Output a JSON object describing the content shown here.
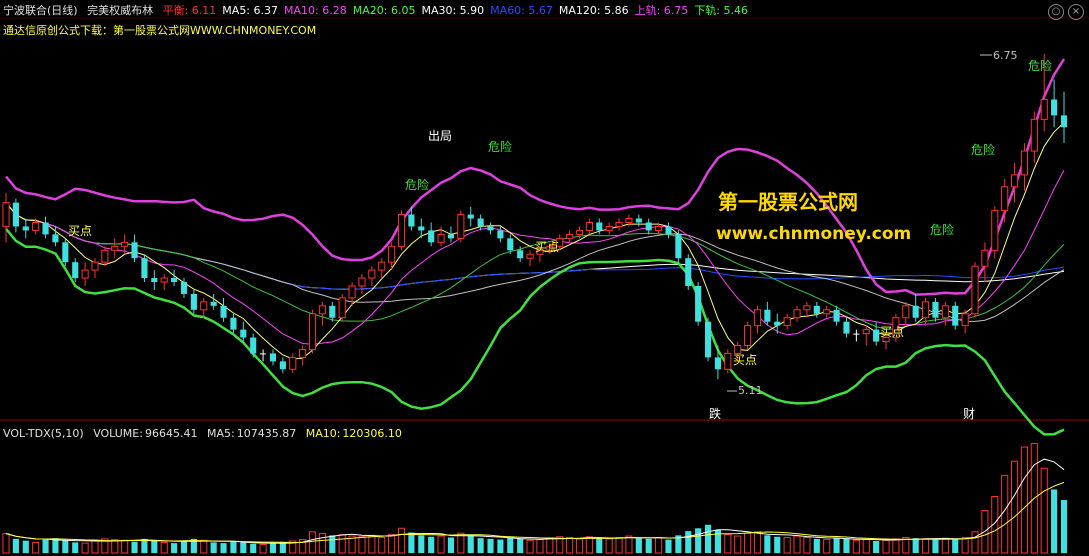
{
  "header": {
    "stock_name": "宁波联合",
    "period": "(日线)",
    "indicator": "完美权威布林",
    "items": [
      {
        "label": "平衡:",
        "value": "6.11",
        "color": "#ff3030"
      },
      {
        "label": "MA5:",
        "value": "6.37",
        "color": "#ffffff"
      },
      {
        "label": "MA10:",
        "value": "6.28",
        "color": "#ff40ff"
      },
      {
        "label": "MA20:",
        "value": "6.05",
        "color": "#40ff40"
      },
      {
        "label": "MA30:",
        "value": "5.90",
        "color": "#ffffff"
      },
      {
        "label": "MA60:",
        "value": "5.67",
        "color": "#2050ff"
      },
      {
        "label": "MA120:",
        "value": "5.86",
        "color": "#ffffff"
      },
      {
        "label": "上轨:",
        "value": "6.75",
        "color": "#ff40ff"
      },
      {
        "label": "下轨:",
        "value": "5.46",
        "color": "#40ff40"
      }
    ],
    "sub_text": "通达信原创公式下载：第一股票公式网WWW.CHNMONEY.COM"
  },
  "watermark": {
    "line1": "第一股票公式网",
    "line2": "www.chnmoney.com"
  },
  "annotations": {
    "buy": "买点",
    "danger": "危险",
    "exit": "出局",
    "drop": "跌",
    "cai": "财",
    "high_label": "6.75",
    "low_label": "5.11"
  },
  "volume_header": {
    "name": "VOL-TDX(5,10)",
    "volume_label": "VOLUME:",
    "volume_value": "96645.41",
    "ma5_label": "MA5:",
    "ma5_value": "107435.87",
    "ma10_label": "MA10:",
    "ma10_value": "120306.10"
  },
  "colors": {
    "up": "#ff3030",
    "down": "#40e0e0",
    "doji": "#ffffff",
    "upper": "#e040e0",
    "lower": "#40e040"
  },
  "chart_data": {
    "type": "candlestick",
    "ohlc": [
      [
        5.88,
        6.05,
        5.8,
        6.0
      ],
      [
        6.0,
        6.02,
        5.85,
        5.88
      ],
      [
        5.88,
        5.92,
        5.82,
        5.86
      ],
      [
        5.86,
        5.92,
        5.84,
        5.9
      ],
      [
        5.9,
        5.93,
        5.82,
        5.84
      ],
      [
        5.84,
        5.88,
        5.78,
        5.8
      ],
      [
        5.8,
        5.82,
        5.68,
        5.7
      ],
      [
        5.7,
        5.72,
        5.6,
        5.62
      ],
      [
        5.62,
        5.7,
        5.58,
        5.66
      ],
      [
        5.66,
        5.72,
        5.62,
        5.7
      ],
      [
        5.7,
        5.78,
        5.68,
        5.76
      ],
      [
        5.76,
        5.82,
        5.72,
        5.78
      ],
      [
        5.78,
        5.84,
        5.74,
        5.8
      ],
      [
        5.8,
        5.84,
        5.7,
        5.72
      ],
      [
        5.72,
        5.74,
        5.6,
        5.62
      ],
      [
        5.62,
        5.66,
        5.56,
        5.6
      ],
      [
        5.6,
        5.64,
        5.56,
        5.62
      ],
      [
        5.62,
        5.66,
        5.58,
        5.6
      ],
      [
        5.6,
        5.62,
        5.52,
        5.54
      ],
      [
        5.54,
        5.56,
        5.44,
        5.46
      ],
      [
        5.46,
        5.52,
        5.42,
        5.5
      ],
      [
        5.5,
        5.54,
        5.46,
        5.48
      ],
      [
        5.48,
        5.52,
        5.4,
        5.42
      ],
      [
        5.42,
        5.44,
        5.34,
        5.36
      ],
      [
        5.36,
        5.4,
        5.3,
        5.32
      ],
      [
        5.32,
        5.34,
        5.22,
        5.24
      ],
      [
        5.24,
        5.26,
        5.2,
        5.24
      ],
      [
        5.24,
        5.26,
        5.18,
        5.2
      ],
      [
        5.2,
        5.22,
        5.14,
        5.16
      ],
      [
        5.16,
        5.24,
        5.14,
        5.22
      ],
      [
        5.22,
        5.28,
        5.18,
        5.26
      ],
      [
        5.26,
        5.46,
        5.24,
        5.44
      ],
      [
        5.44,
        5.5,
        5.38,
        5.48
      ],
      [
        5.48,
        5.5,
        5.4,
        5.42
      ],
      [
        5.42,
        5.54,
        5.4,
        5.52
      ],
      [
        5.52,
        5.6,
        5.48,
        5.58
      ],
      [
        5.58,
        5.64,
        5.54,
        5.62
      ],
      [
        5.62,
        5.68,
        5.58,
        5.66
      ],
      [
        5.66,
        5.72,
        5.62,
        5.7
      ],
      [
        5.7,
        5.8,
        5.66,
        5.78
      ],
      [
        5.78,
        5.96,
        5.76,
        5.94
      ],
      [
        5.94,
        5.98,
        5.86,
        5.88
      ],
      [
        5.88,
        5.92,
        5.82,
        5.86
      ],
      [
        5.86,
        5.9,
        5.78,
        5.8
      ],
      [
        5.8,
        5.88,
        5.78,
        5.84
      ],
      [
        5.84,
        5.88,
        5.8,
        5.82
      ],
      [
        5.82,
        5.96,
        5.8,
        5.94
      ],
      [
        5.94,
        5.98,
        5.88,
        5.92
      ],
      [
        5.92,
        5.94,
        5.86,
        5.88
      ],
      [
        5.88,
        5.9,
        5.84,
        5.86
      ],
      [
        5.86,
        5.88,
        5.8,
        5.82
      ],
      [
        5.82,
        5.84,
        5.74,
        5.76
      ],
      [
        5.76,
        5.78,
        5.7,
        5.72
      ],
      [
        5.72,
        5.76,
        5.68,
        5.74
      ],
      [
        5.74,
        5.78,
        5.7,
        5.76
      ],
      [
        5.76,
        5.8,
        5.74,
        5.78
      ],
      [
        5.78,
        5.84,
        5.76,
        5.82
      ],
      [
        5.82,
        5.86,
        5.8,
        5.84
      ],
      [
        5.84,
        5.88,
        5.82,
        5.86
      ],
      [
        5.86,
        5.92,
        5.84,
        5.9
      ],
      [
        5.9,
        5.92,
        5.84,
        5.86
      ],
      [
        5.86,
        5.9,
        5.84,
        5.88
      ],
      [
        5.88,
        5.92,
        5.86,
        5.9
      ],
      [
        5.9,
        5.94,
        5.88,
        5.92
      ],
      [
        5.92,
        5.94,
        5.88,
        5.9
      ],
      [
        5.9,
        5.92,
        5.84,
        5.86
      ],
      [
        5.86,
        5.9,
        5.84,
        5.88
      ],
      [
        5.88,
        5.9,
        5.82,
        5.84
      ],
      [
        5.84,
        5.86,
        5.7,
        5.72
      ],
      [
        5.72,
        5.74,
        5.56,
        5.58
      ],
      [
        5.58,
        5.6,
        5.38,
        5.4
      ],
      [
        5.4,
        5.42,
        5.2,
        5.22
      ],
      [
        5.22,
        5.28,
        5.11,
        5.16
      ],
      [
        5.16,
        5.26,
        5.14,
        5.24
      ],
      [
        5.24,
        5.3,
        5.2,
        5.28
      ],
      [
        5.28,
        5.4,
        5.26,
        5.38
      ],
      [
        5.38,
        5.48,
        5.34,
        5.46
      ],
      [
        5.46,
        5.5,
        5.38,
        5.4
      ],
      [
        5.4,
        5.44,
        5.34,
        5.38
      ],
      [
        5.38,
        5.44,
        5.36,
        5.42
      ],
      [
        5.42,
        5.48,
        5.4,
        5.46
      ],
      [
        5.46,
        5.5,
        5.42,
        5.48
      ],
      [
        5.48,
        5.5,
        5.42,
        5.44
      ],
      [
        5.44,
        5.48,
        5.42,
        5.46
      ],
      [
        5.46,
        5.48,
        5.38,
        5.4
      ],
      [
        5.4,
        5.42,
        5.32,
        5.34
      ],
      [
        5.34,
        5.36,
        5.3,
        5.34
      ],
      [
        5.34,
        5.38,
        5.28,
        5.36
      ],
      [
        5.36,
        5.4,
        5.28,
        5.3
      ],
      [
        5.3,
        5.34,
        5.26,
        5.32
      ],
      [
        5.32,
        5.44,
        5.3,
        5.42
      ],
      [
        5.42,
        5.5,
        5.38,
        5.48
      ],
      [
        5.48,
        5.54,
        5.4,
        5.42
      ],
      [
        5.42,
        5.52,
        5.38,
        5.5
      ],
      [
        5.5,
        5.52,
        5.4,
        5.42
      ],
      [
        5.42,
        5.5,
        5.38,
        5.48
      ],
      [
        5.48,
        5.5,
        5.36,
        5.38
      ],
      [
        5.38,
        5.46,
        5.34,
        5.44
      ],
      [
        5.44,
        5.7,
        5.42,
        5.68
      ],
      [
        5.68,
        5.8,
        5.6,
        5.76
      ],
      [
        5.76,
        5.98,
        5.72,
        5.96
      ],
      [
        5.96,
        6.12,
        5.9,
        6.08
      ],
      [
        6.08,
        6.2,
        6.0,
        6.14
      ],
      [
        6.14,
        6.3,
        6.06,
        6.26
      ],
      [
        6.26,
        6.46,
        6.2,
        6.42
      ],
      [
        6.42,
        6.75,
        6.36,
        6.52
      ],
      [
        6.52,
        6.62,
        6.38,
        6.44
      ],
      [
        6.44,
        6.56,
        6.3,
        6.38
      ]
    ],
    "volume": [
      55,
      40,
      35,
      30,
      38,
      42,
      36,
      30,
      28,
      34,
      40,
      38,
      36,
      32,
      40,
      35,
      30,
      28,
      34,
      40,
      36,
      30,
      28,
      32,
      30,
      26,
      24,
      28,
      30,
      34,
      38,
      60,
      55,
      50,
      52,
      48,
      46,
      50,
      44,
      52,
      70,
      58,
      50,
      46,
      48,
      44,
      56,
      50,
      42,
      40,
      38,
      44,
      40,
      36,
      38,
      42,
      46,
      44,
      40,
      46,
      42,
      40,
      44,
      48,
      42,
      40,
      44,
      38,
      50,
      62,
      70,
      80,
      66,
      52,
      48,
      56,
      60,
      50,
      46,
      44,
      48,
      44,
      40,
      38,
      42,
      40,
      36,
      38,
      34,
      36,
      40,
      44,
      42,
      40,
      38,
      42,
      40,
      44,
      60,
      120,
      160,
      220,
      260,
      300,
      310,
      240,
      180,
      150
    ]
  }
}
